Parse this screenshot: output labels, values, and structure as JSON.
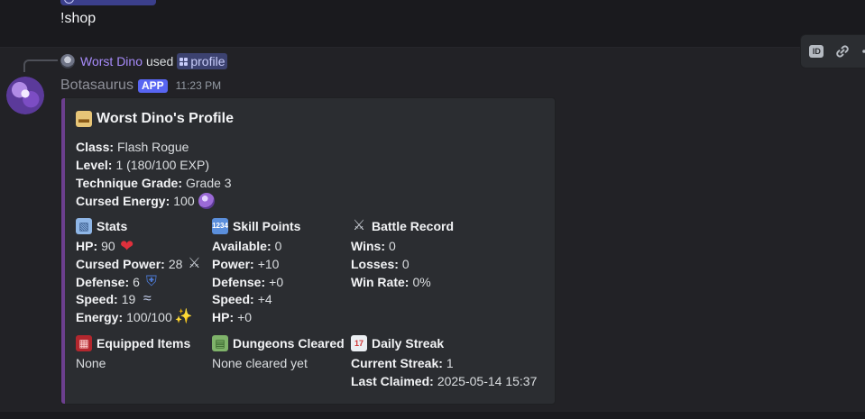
{
  "previous_message": {
    "text": "!shop"
  },
  "reply": {
    "user": "Worst Dino",
    "action": "used",
    "command": "profile"
  },
  "author": {
    "name": "Botasaurus",
    "badge": "APP",
    "time": "11:23 PM"
  },
  "toolbar": {
    "id_label": "ID",
    "items": [
      "id-icon",
      "link-icon",
      "more-icon"
    ]
  },
  "embed": {
    "accent_color": "#6c3f8e",
    "title": "Worst Dino's Profile",
    "info": [
      {
        "label": "Class:",
        "value": "Flash Rogue"
      },
      {
        "label": "Level:",
        "value": "1 (180/100 EXP)"
      },
      {
        "label": "Technique Grade:",
        "value": "Grade 3"
      },
      {
        "label": "Cursed Energy:",
        "value": "100"
      }
    ],
    "stats": {
      "title": "Stats",
      "rows": [
        {
          "label": "HP:",
          "value": "90"
        },
        {
          "label": "Cursed Power:",
          "value": "28"
        },
        {
          "label": "Defense:",
          "value": "6"
        },
        {
          "label": "Speed:",
          "value": "19"
        },
        {
          "label": "Energy:",
          "value": "100/100"
        }
      ]
    },
    "skill_points": {
      "title": "Skill Points",
      "rows": [
        {
          "label": "Available:",
          "value": "0"
        },
        {
          "label": "Power:",
          "value": "+10"
        },
        {
          "label": "Defense:",
          "value": "+0"
        },
        {
          "label": "Speed:",
          "value": "+4"
        },
        {
          "label": "HP:",
          "value": "+0"
        }
      ]
    },
    "battle_record": {
      "title": "Battle Record",
      "rows": [
        {
          "label": "Wins:",
          "value": "0"
        },
        {
          "label": "Losses:",
          "value": "0"
        },
        {
          "label": "Win Rate:",
          "value": "0%"
        }
      ]
    },
    "equipped_items": {
      "title": "Equipped Items",
      "value": "None"
    },
    "dungeons_cleared": {
      "title": "Dungeons Cleared",
      "value": "None cleared yet"
    },
    "daily_streak": {
      "title": "Daily Streak",
      "rows": [
        {
          "label": "Current Streak:",
          "value": "1"
        },
        {
          "label": "Last Claimed:",
          "value": "2025-05-14 15:37"
        }
      ]
    }
  }
}
